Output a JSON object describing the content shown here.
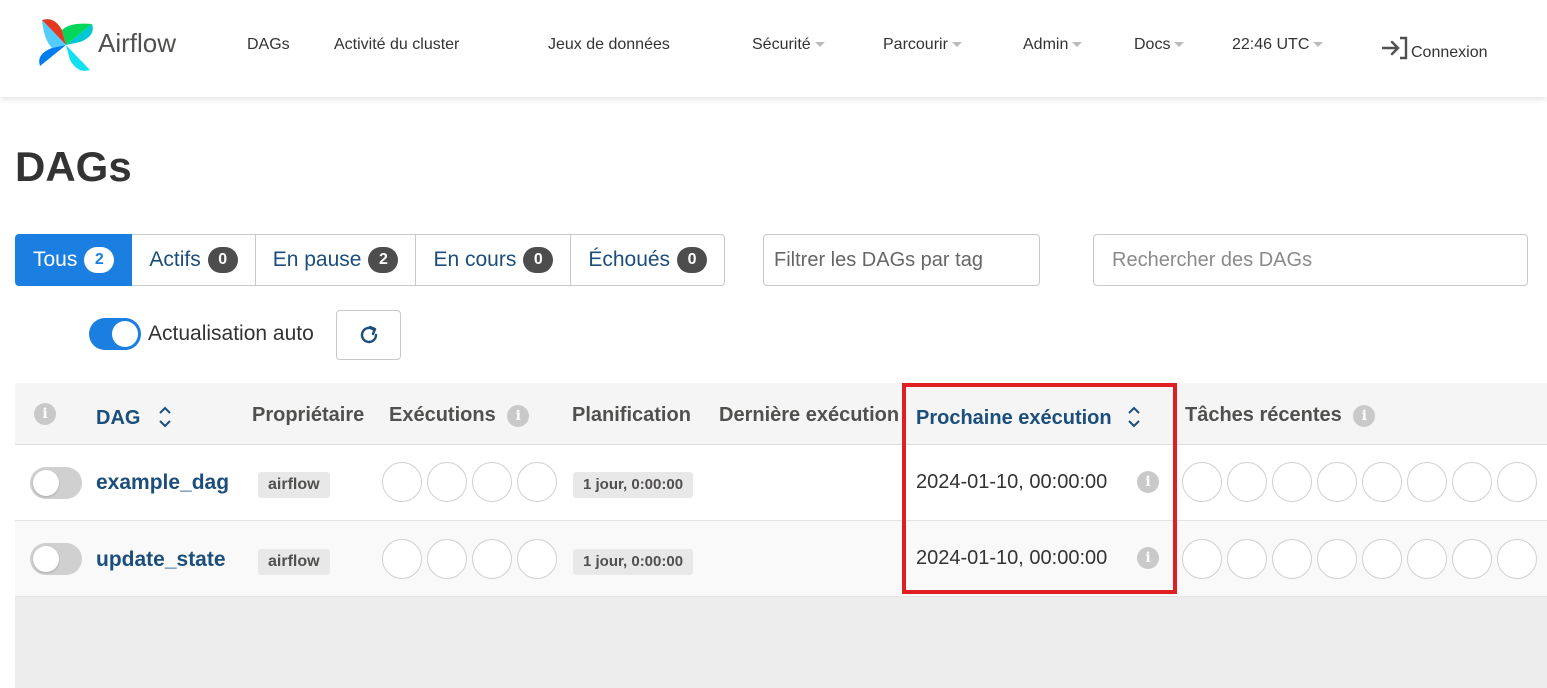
{
  "navbar": {
    "brand": "Airflow",
    "items": [
      {
        "label": "DAGs",
        "dropdown": false
      },
      {
        "label": "Activité du cluster",
        "dropdown": false
      },
      {
        "label": "Jeux de données",
        "dropdown": false
      },
      {
        "label": "Sécurité",
        "dropdown": true
      },
      {
        "label": "Parcourir",
        "dropdown": true
      },
      {
        "label": "Admin",
        "dropdown": true
      },
      {
        "label": "Docs",
        "dropdown": true
      },
      {
        "label": "22:46 UTC",
        "dropdown": true
      }
    ],
    "login": "Connexion"
  },
  "page": {
    "title": "DAGs"
  },
  "status_filters": [
    {
      "label": "Tous",
      "count": "2",
      "active": true
    },
    {
      "label": "Actifs",
      "count": "0",
      "active": false
    },
    {
      "label": "En pause",
      "count": "2",
      "active": false
    },
    {
      "label": "En cours",
      "count": "0",
      "active": false
    },
    {
      "label": "Échoués",
      "count": "0",
      "active": false
    }
  ],
  "filters": {
    "tag_placeholder": "Filtrer les DAGs par tag",
    "search_placeholder": "Rechercher des DAGs"
  },
  "auto_refresh": {
    "label": "Actualisation auto",
    "enabled": true
  },
  "table": {
    "headers": {
      "info": "i",
      "dag": "DAG",
      "owner": "Propriétaire",
      "runs": "Exécutions",
      "schedule": "Planification",
      "last_run": "Dernière exécution",
      "next_run": "Prochaine exécution",
      "recent_tasks": "Tâches récentes"
    },
    "rows": [
      {
        "dag_id": "example_dag",
        "owner": "airflow",
        "schedule": "1 jour, 0:00:00",
        "next_run": "2024-01-10, 00:00:00",
        "paused": true
      },
      {
        "dag_id": "update_state",
        "owner": "airflow",
        "schedule": "1 jour, 0:00:00",
        "next_run": "2024-01-10, 00:00:00",
        "paused": true
      }
    ]
  },
  "colors": {
    "accent": "#1a7fe0",
    "link": "#1b4e7a",
    "highlight": "#e02020"
  }
}
